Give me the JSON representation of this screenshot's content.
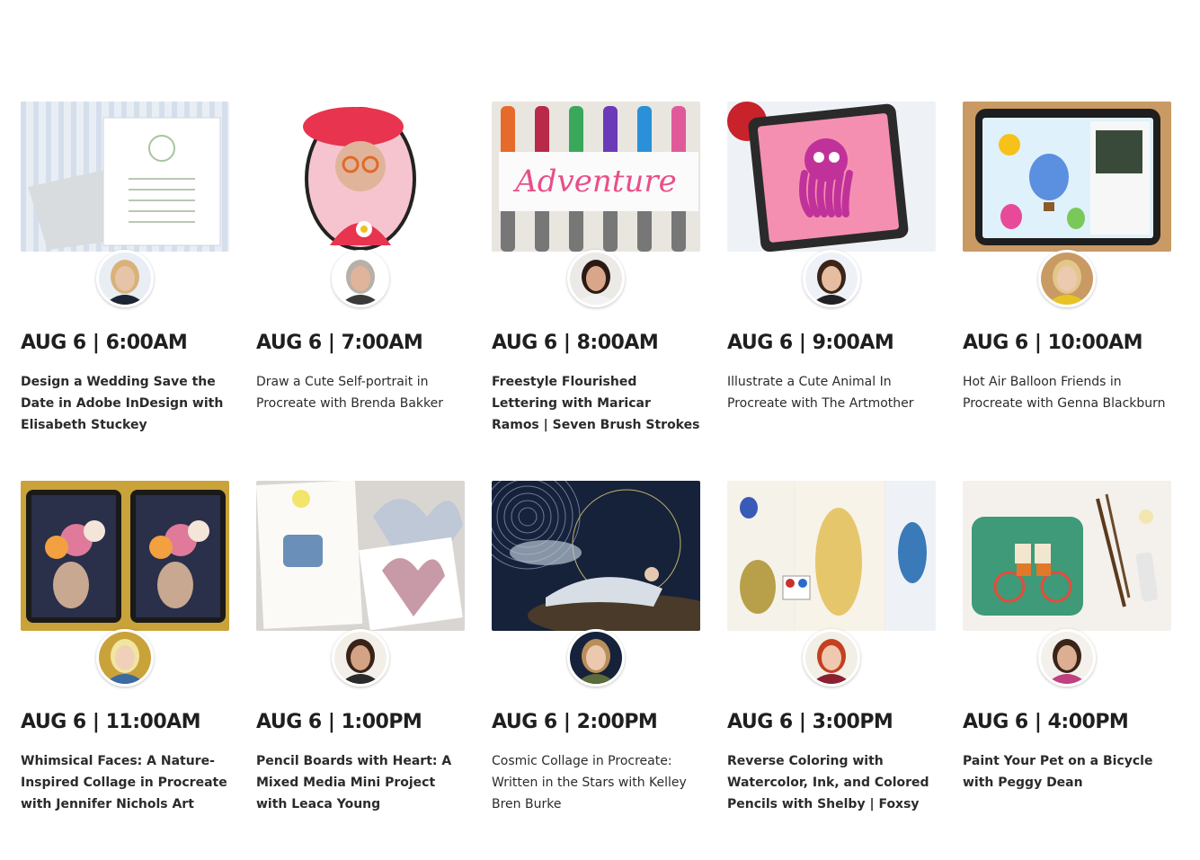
{
  "classes": [
    {
      "datetime": "AUG 6 | 6:00AM",
      "title": "Design a Wedding Save the Date in Adobe InDesign with Elisabeth Stuckey",
      "thumb_icon": "wedding-invitation-icon",
      "colors": {
        "bg": "#e9eef5",
        "accent": "#a8c4a0",
        "skin": "#e5c4a8",
        "hair": "#d9b27a",
        "cloth": "#1d2433"
      }
    },
    {
      "datetime": "AUG 6 | 7:00AM",
      "title": "Draw a Cute Self-portrait in Procreate with Brenda Bakker",
      "thumb_icon": "cartoon-portrait-icon",
      "colors": {
        "bg": "#ffffff",
        "accent": "#e8344e",
        "skin": "#e0b49a",
        "hair": "#b8b0a8",
        "cloth": "#3a3a3a"
      }
    },
    {
      "datetime": "AUG 6 | 8:00AM",
      "title": "Freestyle Flourished Lettering with Maricar Ramos | Seven Brush Strokes",
      "thumb_icon": "lettering-markers-icon",
      "colors": {
        "bg": "#eceae6",
        "accent": "#e84f8a",
        "skin": "#d9a68a",
        "hair": "#2b1a14",
        "cloth": "#f2f2f2"
      }
    },
    {
      "datetime": "AUG 6 | 9:00AM",
      "title": "Illustrate a Cute Animal In Procreate with The Artmother",
      "thumb_icon": "octopus-tablet-icon",
      "colors": {
        "bg": "#eef2f7",
        "accent": "#e85da0",
        "skin": "#e6bda0",
        "hair": "#3b2418",
        "cloth": "#222222"
      }
    },
    {
      "datetime": "AUG 6 | 10:00AM",
      "title": "Hot Air Balloon Friends in Procreate with Genna Blackburn",
      "thumb_icon": "balloon-tablet-icon",
      "colors": {
        "bg": "#c99a64",
        "accent": "#5b8fe0",
        "skin": "#eccab0",
        "hair": "#e3c78a",
        "cloth": "#e9c326"
      }
    },
    {
      "datetime": "AUG 6 | 11:00AM",
      "title": "Whimsical Faces: A Nature-Inspired Collage in Procreate with Jennifer Nichols Art",
      "thumb_icon": "floral-collage-tablets-icon",
      "colors": {
        "bg": "#c9a23a",
        "accent": "#e07a9a",
        "skin": "#f0d0b8",
        "hair": "#f0e6a0",
        "cloth": "#3a6aa0"
      }
    },
    {
      "datetime": "AUG 6 | 1:00PM",
      "title": "Pencil Boards with Heart: A Mixed Media Mini Project with Leaca Young",
      "thumb_icon": "mixed-media-journal-icon",
      "colors": {
        "bg": "#f3efe8",
        "accent": "#6a8fb8",
        "skin": "#d4a284",
        "hair": "#3a2218",
        "cloth": "#2a2a2a"
      }
    },
    {
      "datetime": "AUG 6 | 2:00PM",
      "title": "Cosmic Collage in Procreate: Written in the Stars with Kelley Bren Burke",
      "thumb_icon": "cosmic-collage-icon",
      "colors": {
        "bg": "#16223a",
        "accent": "#c8b070",
        "skin": "#ecc9ae",
        "hair": "#b88f5a",
        "cloth": "#5a6a3a"
      }
    },
    {
      "datetime": "AUG 6 | 3:00PM",
      "title": "Reverse Coloring with Watercolor, Ink, and Colored Pencils with Shelby | Foxsy",
      "thumb_icon": "watercolor-sketchbook-icon",
      "colors": {
        "bg": "#f2efe6",
        "accent": "#3a7ab8",
        "skin": "#f0c8b0",
        "hair": "#c4401e",
        "cloth": "#8a2030"
      }
    },
    {
      "datetime": "AUG 6 | 4:00PM",
      "title": "Paint Your Pet on a Bicycle with Peggy Dean",
      "thumb_icon": "pet-bicycle-painting-icon",
      "colors": {
        "bg": "#f4f1ec",
        "accent": "#3e9a78",
        "skin": "#dcae92",
        "hair": "#3a2418",
        "cloth": "#c04080"
      }
    }
  ]
}
